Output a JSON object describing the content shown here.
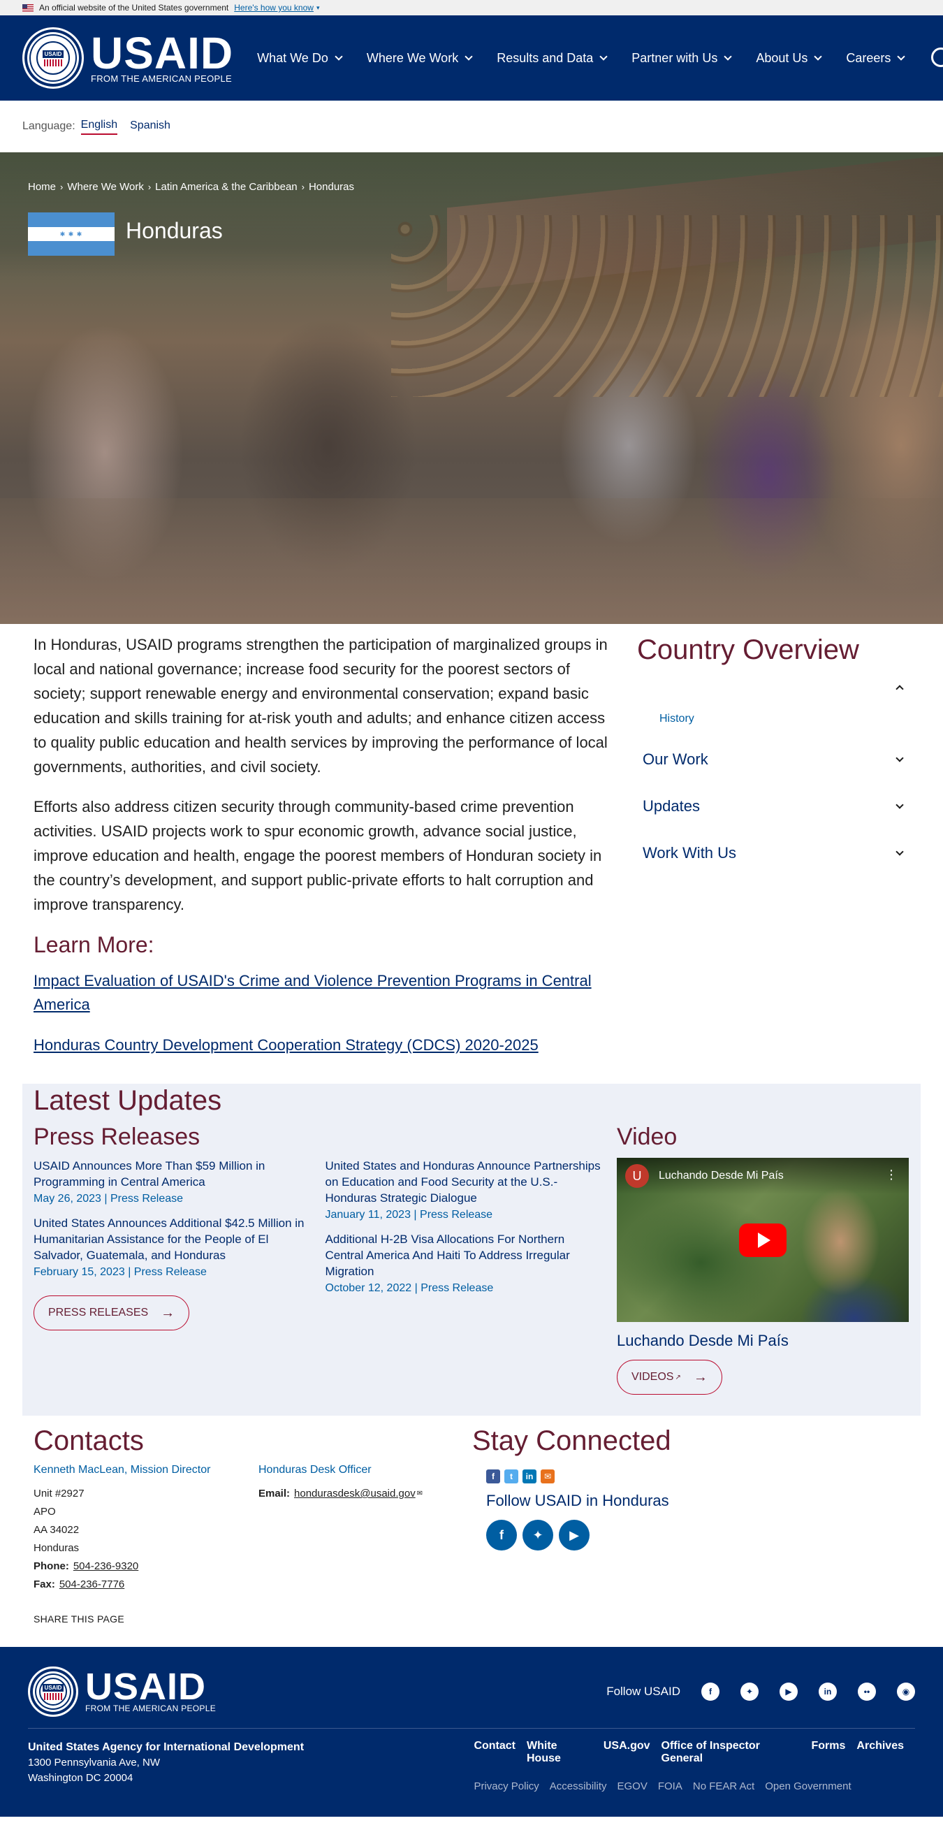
{
  "gov_banner": {
    "text": "An official website of the United States government",
    "link": "Here's how you know"
  },
  "header": {
    "logo_word": "USAID",
    "logo_sub": "FROM THE AMERICAN PEOPLE",
    "seal_word": "USAID",
    "nav": [
      "What We Do",
      "Where We Work",
      "Results and Data",
      "Partner with Us",
      "About Us",
      "Careers"
    ]
  },
  "language": {
    "label": "Language:",
    "options": [
      "English",
      "Spanish"
    ],
    "selected": "English"
  },
  "hero": {
    "breadcrumb": [
      "Home",
      "Where We Work",
      "Latin America & the Caribbean",
      "Honduras"
    ],
    "title": "Honduras"
  },
  "intro": {
    "paragraphs": [
      "In Honduras, USAID programs strengthen the participation of marginalized groups in local and national governance; increase food security for the poorest sectors of society; support renewable energy and environmental conservation; expand basic education and skills training for at-risk youth and adults; and enhance citizen access to quality public education and health services by improving the performance of local governments, authorities, and civil society.",
      "Efforts also address citizen security through community-based crime prevention activities. USAID projects work to spur economic growth, advance social justice, improve education and health, engage the poorest members of Honduran society in the country’s development, and support public-private efforts to halt corruption and improve transparency."
    ],
    "learn_more_title": "Learn More:",
    "learn_more_links": [
      "Impact Evaluation of USAID's Crime and Violence Prevention Programs in Central America",
      "Honduras Country Development Cooperation Strategy (CDCS) 2020-2025"
    ]
  },
  "overview": {
    "title": "Country Overview",
    "sub_link": "History",
    "sections": [
      "Our Work",
      "Updates",
      "Work With Us"
    ]
  },
  "updates": {
    "title": "Latest Updates",
    "press_title": "Press Releases",
    "press_left": [
      {
        "title": "USAID Announces More Than $59 Million in Programming in Central America",
        "date": "May 26, 2023",
        "type": "Press Release"
      },
      {
        "title": "United States Announces Additional $42.5 Million in Humanitarian Assistance for the People of El Salvador, Guatemala, and Honduras",
        "date": "February 15, 2023",
        "type": "Press Release"
      }
    ],
    "press_right": [
      {
        "title": "United States and Honduras Announce Partnerships on Education and Food Security at the U.S.-Honduras Strategic Dialogue",
        "date": "January 11, 2023",
        "type": "Press Release"
      },
      {
        "title": "Additional H-2B Visa Allocations For Northern Central America And Haiti To Address Irregular Migration",
        "date": "October 12, 2022",
        "type": "Press Release"
      }
    ],
    "press_button": "PRESS RELEASES",
    "video_title": "Video",
    "video_channel_initial": "U",
    "video_name": "Luchando Desde Mi País",
    "video_caption": "Luchando Desde Mi País",
    "videos_button": "VIDEOS"
  },
  "contacts": {
    "title": "Contacts",
    "primary": {
      "name": "Kenneth MacLean, Mission Director",
      "address": [
        "Unit #2927",
        "APO",
        "AA 34022",
        "Honduras"
      ],
      "phone_label": "Phone:",
      "phone": "504-236-9320",
      "fax_label": "Fax:",
      "fax": "504-236-7776"
    },
    "desk": {
      "name": "Honduras Desk Officer",
      "email_label": "Email:",
      "email": "hondurasdesk@usaid.gov"
    },
    "share": "SHARE THIS PAGE"
  },
  "stay": {
    "title": "Stay Connected",
    "follow_text": "Follow USAID in Honduras"
  },
  "footer": {
    "follow_label": "Follow USAID",
    "agency": "United States Agency for International Development",
    "address": [
      "1300 Pennsylvania Ave, NW",
      "Washington DC 20004"
    ],
    "primary_links": [
      "Contact",
      "White House",
      "USA.gov",
      "Office of Inspector General",
      "Forms",
      "Archives"
    ],
    "secondary_links": [
      "Privacy Policy",
      "Accessibility",
      "EGOV",
      "FOIA",
      "No FEAR Act",
      "Open Government"
    ]
  },
  "colors": {
    "navy": "#002a6c",
    "maroon": "#651d32",
    "link_blue": "#005ea2",
    "updates_bg": "#edf0f7",
    "accent_red": "#ba0c2f"
  }
}
